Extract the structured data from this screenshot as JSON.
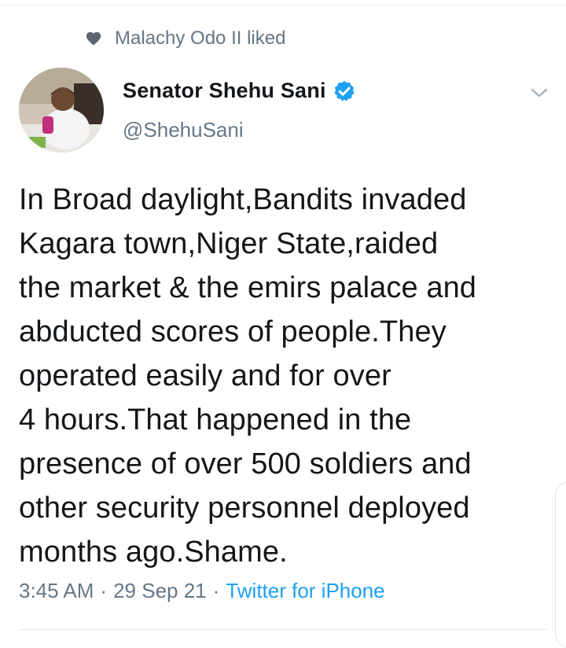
{
  "social_context": {
    "text": "Malachy Odo II liked",
    "icon": "heart-icon"
  },
  "author": {
    "name": "Senator Shehu Sani",
    "handle": "@ShehuSani",
    "verified": true
  },
  "tweet": {
    "lines": [
      "In Broad daylight,Bandits invaded",
      "Kagara town,Niger State,raided",
      "the market & the emirs palace and",
      "abducted scores of people.They",
      "operated easily and for over",
      "4 hours.That happened in the",
      "presence of over 500 soldiers and",
      "other security personnel deployed",
      "months ago.Shame."
    ]
  },
  "meta": {
    "time": "3:45 AM",
    "separator": "·",
    "date": "29 Sep 21",
    "source": "Twitter for iPhone"
  },
  "colors": {
    "accent": "#1da1f2",
    "secondary_text": "#657786",
    "primary_text": "#14171a"
  }
}
